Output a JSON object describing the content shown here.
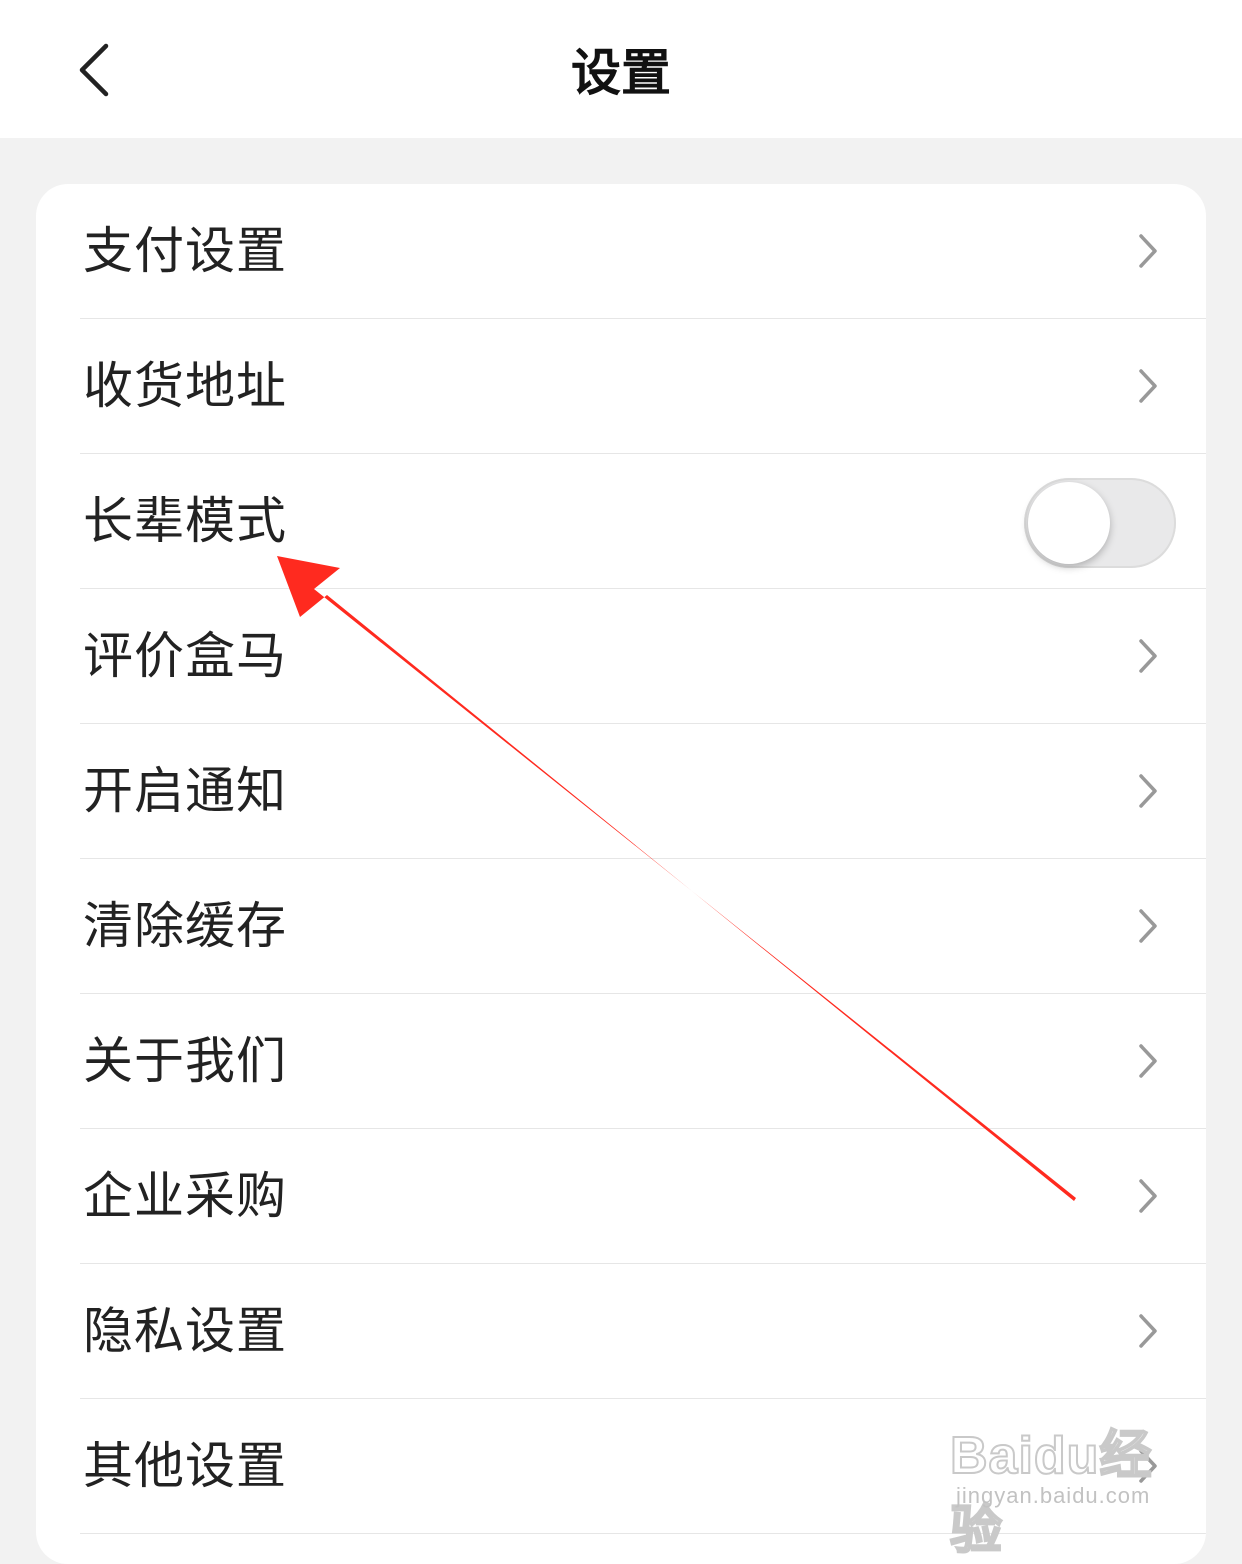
{
  "header": {
    "title": "设置",
    "back_icon": "chevron-left-icon"
  },
  "settings": {
    "items": [
      {
        "label": "支付设置",
        "control": "chevron"
      },
      {
        "label": "收货地址",
        "control": "chevron"
      },
      {
        "label": "长辈模式",
        "control": "toggle",
        "on": false
      },
      {
        "label": "评价盒马",
        "control": "chevron"
      },
      {
        "label": "开启通知",
        "control": "chevron"
      },
      {
        "label": "清除缓存",
        "control": "chevron"
      },
      {
        "label": "关于我们",
        "control": "chevron"
      },
      {
        "label": "企业采购",
        "control": "chevron"
      },
      {
        "label": "隐私设置",
        "control": "chevron"
      },
      {
        "label": "其他设置",
        "control": "chevron"
      }
    ]
  },
  "annotation": {
    "arrow_color": "#ff2a1f",
    "points_to": "长辈模式"
  },
  "watermark": {
    "logo": "Baidu经验",
    "url": "jingyan.baidu.com"
  },
  "colors": {
    "background": "#f2f2f2",
    "card": "#ffffff",
    "text": "#222222",
    "chevron": "#999999",
    "toggle_off": "#e9e9ea"
  }
}
